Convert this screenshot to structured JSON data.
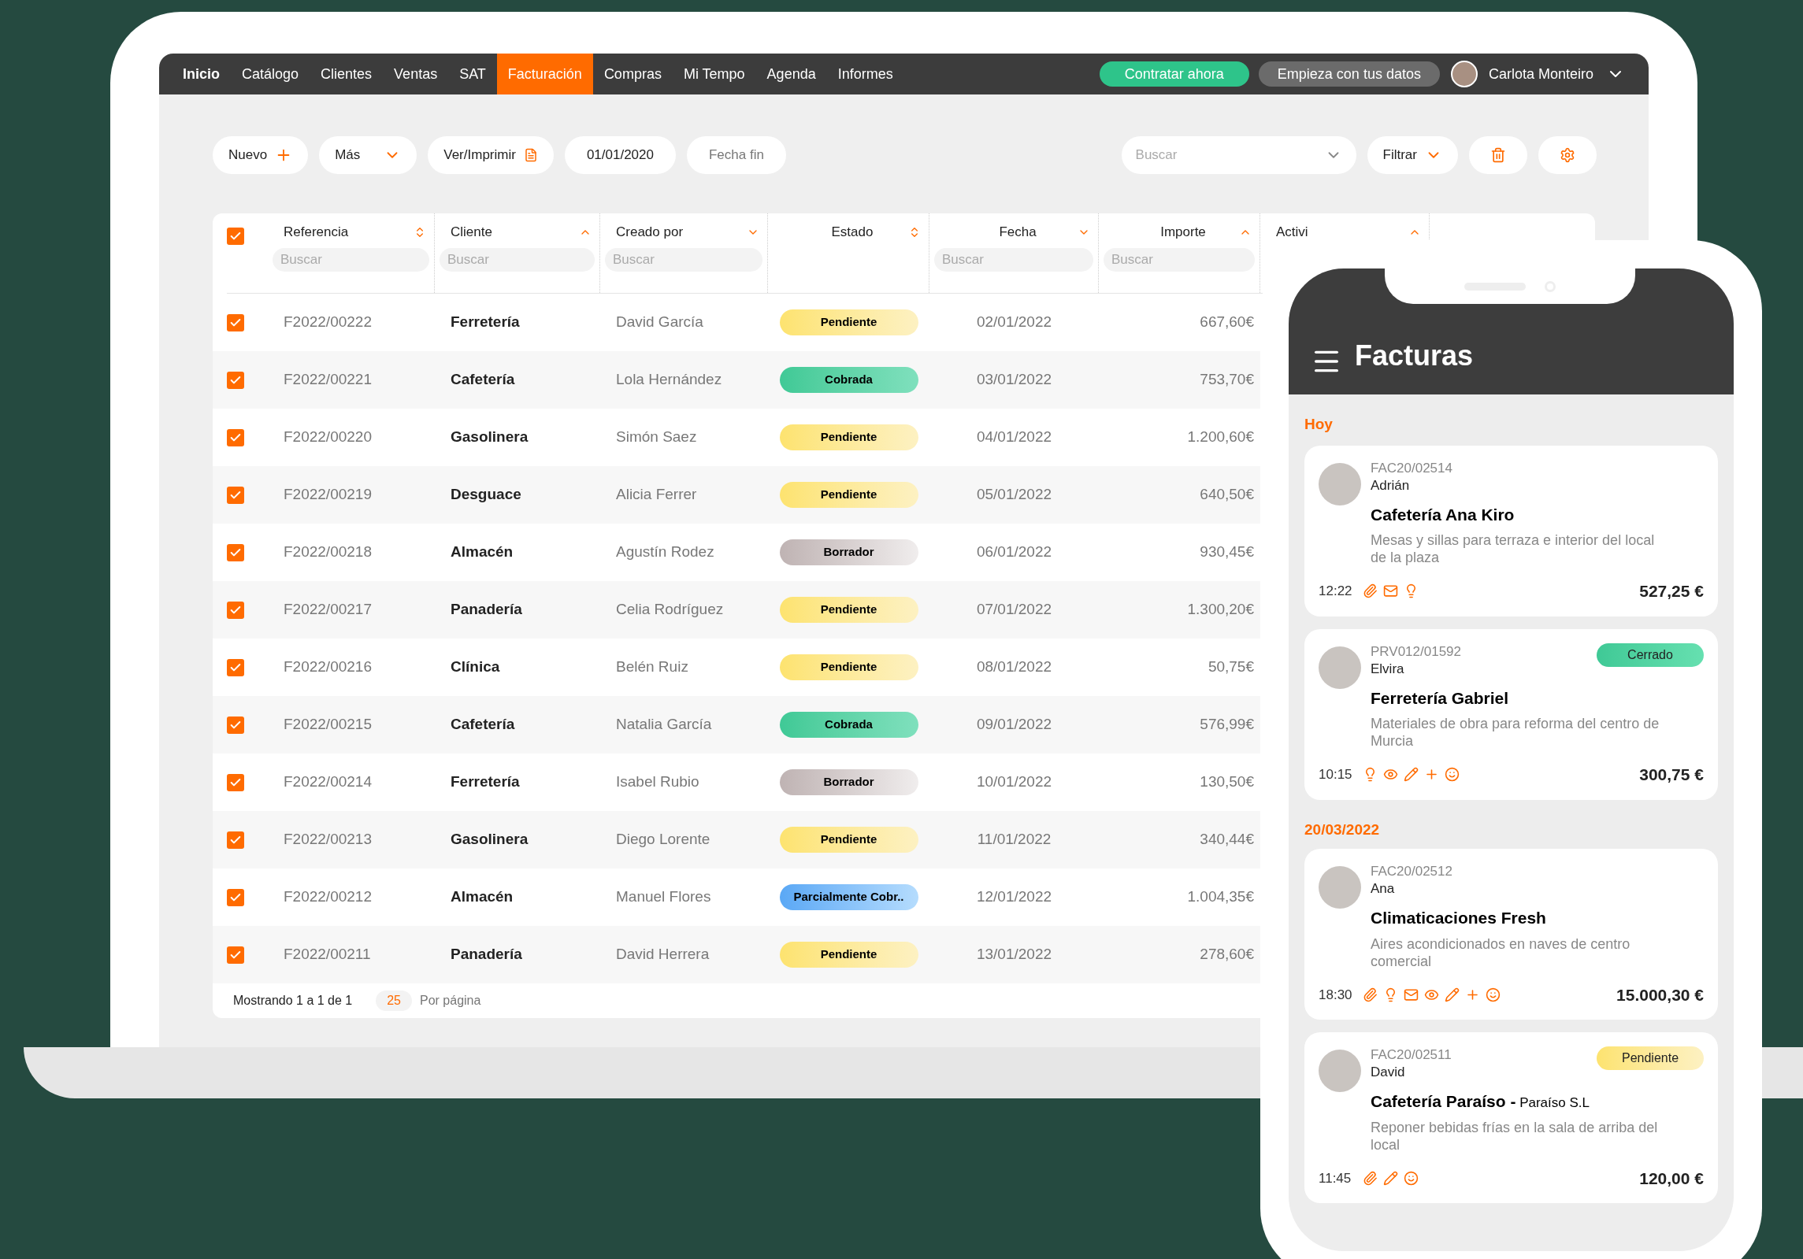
{
  "nav": {
    "items": [
      {
        "label": "Inicio",
        "selected": false
      },
      {
        "label": "Catálogo",
        "selected": false
      },
      {
        "label": "Clientes",
        "selected": false
      },
      {
        "label": "Ventas",
        "selected": false
      },
      {
        "label": "SAT",
        "selected": false
      },
      {
        "label": "Facturación",
        "selected": true
      },
      {
        "label": "Compras",
        "selected": false
      },
      {
        "label": "Mi Tempo",
        "selected": false
      },
      {
        "label": "Agenda",
        "selected": false
      },
      {
        "label": "Informes",
        "selected": false
      }
    ],
    "cta_primary": "Contratar ahora",
    "cta_secondary": "Empieza con tus datos",
    "user": "Carlota Monteiro"
  },
  "toolbar": {
    "new": "Nuevo",
    "more": "Más",
    "print": "Ver/Imprimir",
    "date_start": "01/01/2020",
    "date_end_placeholder": "Fecha fin",
    "search_placeholder": "Buscar",
    "filter": "Filtrar"
  },
  "table": {
    "select_all": {
      "checked": true
    },
    "columns": [
      {
        "label": "Referencia",
        "kind": "both",
        "filter_placeholder": "Buscar"
      },
      {
        "label": "Cliente",
        "kind": "up",
        "filter_placeholder": "Buscar"
      },
      {
        "label": "Creado por",
        "kind": "down",
        "filter_placeholder": "Buscar"
      },
      {
        "label": "Estado",
        "kind": "both"
      },
      {
        "label": "Fecha",
        "kind": "down",
        "filter_placeholder": "Buscar"
      },
      {
        "label": "Importe",
        "kind": "up",
        "filter_placeholder": "Buscar"
      },
      {
        "label": "Activi",
        "kind": "up"
      }
    ],
    "rows": [
      {
        "checked": true,
        "ref": "F2022/00222",
        "client": "Ferretería",
        "creator": "David García",
        "status": {
          "label": "Pendiente",
          "kind": "pending"
        },
        "date": "02/01/2022",
        "amount": "667,60€"
      },
      {
        "checked": true,
        "ref": "F2022/00221",
        "client": "Cafetería",
        "creator": "Lola Hernández",
        "status": {
          "label": "Cobrada",
          "kind": "paid"
        },
        "date": "03/01/2022",
        "amount": "753,70€"
      },
      {
        "checked": true,
        "ref": "F2022/00220",
        "client": "Gasolinera",
        "creator": "Simón Saez",
        "status": {
          "label": "Pendiente",
          "kind": "pending"
        },
        "date": "04/01/2022",
        "amount": "1.200,60€"
      },
      {
        "checked": true,
        "ref": "F2022/00219",
        "client": "Desguace",
        "creator": "Alicia Ferrer",
        "status": {
          "label": "Pendiente",
          "kind": "pending"
        },
        "date": "05/01/2022",
        "amount": "640,50€"
      },
      {
        "checked": true,
        "ref": "F2022/00218",
        "client": "Almacén",
        "creator": "Agustín Rodez",
        "status": {
          "label": "Borrador",
          "kind": "draft"
        },
        "date": "06/01/2022",
        "amount": "930,45€"
      },
      {
        "checked": true,
        "ref": "F2022/00217",
        "client": "Panadería",
        "creator": "Celia Rodríguez",
        "status": {
          "label": "Pendiente",
          "kind": "pending"
        },
        "date": "07/01/2022",
        "amount": "1.300,20€"
      },
      {
        "checked": true,
        "ref": "F2022/00216",
        "client": "Clínica",
        "creator": "Belén Ruiz",
        "status": {
          "label": "Pendiente",
          "kind": "pending"
        },
        "date": "08/01/2022",
        "amount": "50,75€"
      },
      {
        "checked": true,
        "ref": "F2022/00215",
        "client": "Cafetería",
        "creator": "Natalia García",
        "status": {
          "label": "Cobrada",
          "kind": "paid"
        },
        "date": "09/01/2022",
        "amount": "576,99€"
      },
      {
        "checked": true,
        "ref": "F2022/00214",
        "client": "Ferretería",
        "creator": "Isabel Rubio",
        "status": {
          "label": "Borrador",
          "kind": "draft"
        },
        "date": "10/01/2022",
        "amount": "130,50€"
      },
      {
        "checked": true,
        "ref": "F2022/00213",
        "client": "Gasolinera",
        "creator": "Diego Lorente",
        "status": {
          "label": "Pendiente",
          "kind": "pending"
        },
        "date": "11/01/2022",
        "amount": "340,44€"
      },
      {
        "checked": true,
        "ref": "F2022/00212",
        "client": "Almacén",
        "creator": "Manuel Flores",
        "status": {
          "label": "Parcialmente Cobr..",
          "kind": "partial"
        },
        "date": "12/01/2022",
        "amount": "1.004,35€"
      },
      {
        "checked": true,
        "ref": "F2022/00211",
        "client": "Panadería",
        "creator": "David Herrera",
        "status": {
          "label": "Pendiente",
          "kind": "pending"
        },
        "date": "13/01/2022",
        "amount": "278,60€"
      }
    ],
    "footer": {
      "showing": "Mostrando 1 a 1 de 1",
      "per_page": "25",
      "per_page_label": "Por página"
    }
  },
  "phone": {
    "title": "Facturas",
    "sections": [
      {
        "label": "Hoy",
        "cards": [
          {
            "id": "FAC20/02514",
            "person": "Adrián",
            "title": "Cafetería Ana Kiro",
            "description": "Mesas y sillas para terraza e interior del local de la plaza",
            "time": "12:22",
            "icons": [
              {
                "kind": "clip"
              },
              {
                "kind": "mail"
              },
              {
                "kind": "bulb"
              }
            ],
            "amount": "527,25 €"
          },
          {
            "id": "PRV012/01592",
            "person": "Elvira",
            "title": "Ferretería Gabriel",
            "description": "Materiales de obra para reforma del centro de Murcia",
            "time": "10:15",
            "icons": [
              {
                "kind": "bulb"
              },
              {
                "kind": "eye"
              },
              {
                "kind": "pencil"
              },
              {
                "kind": "plus"
              },
              {
                "kind": "smile"
              }
            ],
            "amount": "300,75 €",
            "status": {
              "label": "Cerrado",
              "kind": "closed"
            }
          }
        ]
      },
      {
        "label": "20/03/2022",
        "cards": [
          {
            "id": "FAC20/02512",
            "person": "Ana",
            "title": "Climaticaciones Fresh",
            "description": "Aires acondicionados en naves de centro comercial",
            "time": "18:30",
            "icons": [
              {
                "kind": "clip"
              },
              {
                "kind": "bulb"
              },
              {
                "kind": "mail"
              },
              {
                "kind": "eye"
              },
              {
                "kind": "pencil"
              },
              {
                "kind": "plus"
              },
              {
                "kind": "smile"
              }
            ],
            "amount": "15.000,30 €"
          },
          {
            "id": "FAC20/02511",
            "person": "David",
            "title": "Cafetería Paraíso -",
            "title_suffix": "Paraíso S.L",
            "description": "Reponer bebidas frías en la sala de arriba del local",
            "time": "11:45",
            "icons": [
              {
                "kind": "clip"
              },
              {
                "kind": "pencil"
              },
              {
                "kind": "smile"
              }
            ],
            "amount": "120,00 €",
            "status": {
              "label": "Pendiente",
              "kind": "pending"
            }
          }
        ]
      }
    ]
  }
}
